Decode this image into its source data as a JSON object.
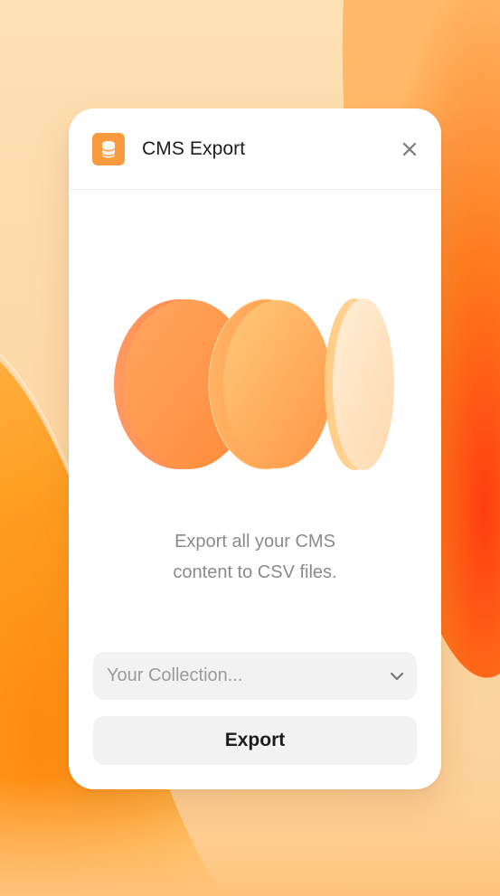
{
  "window": {
    "title": "CMS Export",
    "app_icon": "database-icon",
    "close_icon": "close-icon"
  },
  "main": {
    "illustration": "stacked-discs-illustration",
    "description_lines": [
      "Export all your CMS",
      "content to CSV files."
    ]
  },
  "form": {
    "collection_select": {
      "placeholder": "Your Collection...",
      "icon": "chevron-down-icon"
    },
    "export_label": "Export"
  },
  "colors": {
    "accent": "#f89a3e",
    "background": "#fcd6a0",
    "button_bg": "#f2f2f2",
    "muted_text": "#8a8a8a"
  }
}
